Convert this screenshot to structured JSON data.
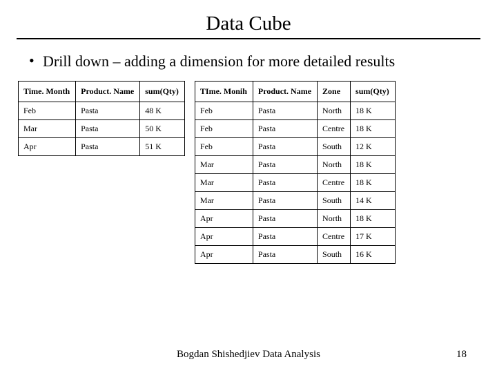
{
  "title": "Data Cube",
  "bullet": "Drill down – adding a dimension for more detailed results",
  "table1": {
    "headers": [
      "Time. Month",
      "Product. Name",
      "sum(Qty)"
    ],
    "rows": [
      [
        "Feb",
        "Pasta",
        "48 K"
      ],
      [
        "Mar",
        "Pasta",
        "50 K"
      ],
      [
        "Apr",
        "Pasta",
        "51 K"
      ]
    ]
  },
  "table2": {
    "headers": [
      "TIme. Monih",
      "Product. Name",
      "Zone",
      "sum(Qty)"
    ],
    "rows": [
      [
        "Feb",
        "Pasta",
        "North",
        "18 K"
      ],
      [
        "Feb",
        "Pasta",
        "Centre",
        "18 K"
      ],
      [
        "Feb",
        "Pasta",
        "South",
        "12 K"
      ],
      [
        "Mar",
        "Pasta",
        "North",
        "18 K"
      ],
      [
        "Mar",
        "Pasta",
        "Centre",
        "18 K"
      ],
      [
        "Mar",
        "Pasta",
        "South",
        "14 K"
      ],
      [
        "Apr",
        "Pasta",
        "North",
        "18 K"
      ],
      [
        "Apr",
        "Pasta",
        "Centre",
        "17 K"
      ],
      [
        "Apr",
        "Pasta",
        "South",
        "16 K"
      ]
    ]
  },
  "footer": "Bogdan Shishedjiev Data Analysis",
  "page_number": "18"
}
